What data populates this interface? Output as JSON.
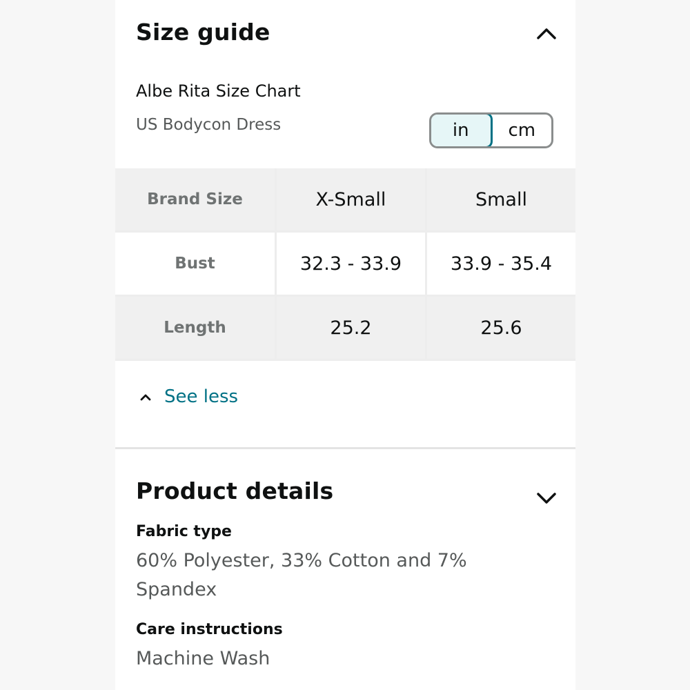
{
  "size_guide": {
    "title": "Size guide",
    "chart_title": "Albe Rita Size Chart",
    "chart_subtitle": "US Bodycon Dress",
    "units": {
      "options": [
        "in",
        "cm"
      ],
      "selected": "in"
    },
    "table": {
      "header_label": "Brand Size",
      "columns": [
        "X-Small",
        "Small"
      ],
      "rows": [
        {
          "label": "Bust",
          "values": [
            "32.3 - 33.9",
            "33.9 - 35.4"
          ]
        },
        {
          "label": "Length",
          "values": [
            "25.2",
            "25.6"
          ]
        }
      ]
    },
    "see_less_label": "See less",
    "icons": {
      "collapse": "chevron-up-icon",
      "see_less": "caret-up-icon"
    }
  },
  "product_details": {
    "title": "Product details",
    "fabric_label": "Fabric type",
    "fabric_value": "60% Polyester, 33% Cotton and 7% Spandex",
    "care_label": "Care instructions",
    "care_value": "Machine Wash",
    "icons": {
      "expand": "chevron-down-icon"
    }
  },
  "colors": {
    "link": "#007185",
    "toggle_active_bg": "#e6f6f7",
    "text_primary": "#0f1111",
    "text_secondary": "#565959"
  }
}
